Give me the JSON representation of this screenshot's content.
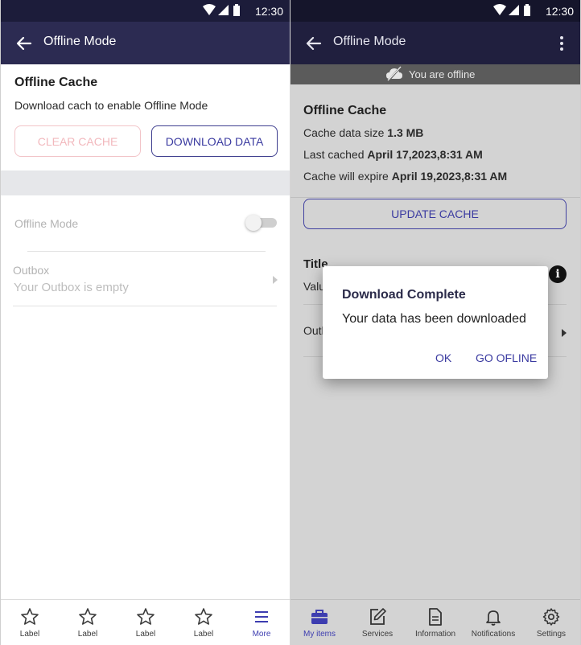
{
  "status_bar": {
    "time": "12:30"
  },
  "left": {
    "appbar": {
      "title": "Offline Mode"
    },
    "cache": {
      "title": "Offline Cache",
      "description": "Download cach to enable Offline Mode",
      "clear_label": "CLEAR CACHE",
      "download_label": "DOWNLOAD DATA"
    },
    "offline_mode": {
      "label": "Offline Mode",
      "enabled": false
    },
    "outbox": {
      "label": "Outbox",
      "value": "Your Outbox is empty"
    },
    "bottom_nav": [
      {
        "label": "Label",
        "icon": "star-icon"
      },
      {
        "label": "Label",
        "icon": "star-icon"
      },
      {
        "label": "Label",
        "icon": "star-icon"
      },
      {
        "label": "Label",
        "icon": "star-icon"
      },
      {
        "label": "More",
        "icon": "menu-icon",
        "active": true
      }
    ]
  },
  "right": {
    "appbar": {
      "title": "Offline Mode"
    },
    "banner": {
      "text": "You are offline"
    },
    "cache": {
      "title": "Offline Cache",
      "size_label": "Cache data size",
      "size_value": "1.3 MB",
      "last_label": "Last cached",
      "last_value": "April 17,2023,8:31 AM",
      "expire_label": "Cache will expire",
      "expire_value": "April 19,2023,8:31 AM",
      "update_label": "UPDATE CACHE"
    },
    "section": {
      "title": "Title",
      "value_partial": "Valu",
      "outbox_partial": "Outl"
    },
    "dialog": {
      "title": "Download Complete",
      "message": "Your data has been downloaded",
      "ok_label": "OK",
      "go_offline_label": "GO OFLINE"
    },
    "bottom_nav": [
      {
        "label": "My items",
        "icon": "briefcase-icon",
        "active": true
      },
      {
        "label": "Services",
        "icon": "edit-icon"
      },
      {
        "label": "Information",
        "icon": "document-icon"
      },
      {
        "label": "Notifications",
        "icon": "bell-icon"
      },
      {
        "label": "Settings",
        "icon": "gear-icon"
      }
    ]
  },
  "colors": {
    "appbar": "#2c2b52",
    "statusbar": "#1c1c3a",
    "accent": "#3a3aa0",
    "disabled_red": "#f2b8bd"
  }
}
